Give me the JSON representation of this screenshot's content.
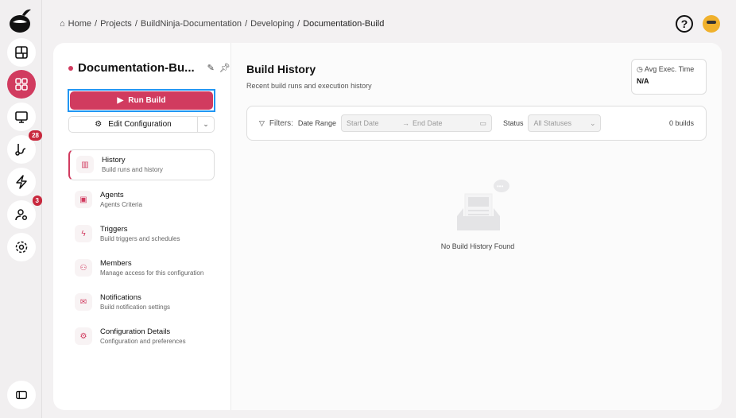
{
  "breadcrumb": {
    "items": [
      "Home",
      "Projects",
      "BuildNinja-Documentation",
      "Developing",
      "Documentation-Build"
    ],
    "separator": "/"
  },
  "rail": {
    "badges": {
      "vcs": "28",
      "users": "3"
    }
  },
  "config": {
    "title": "Documentation-Bu...",
    "run_label": "Run Build",
    "edit_label": "Edit Configuration"
  },
  "nav": [
    {
      "label": "History",
      "sub": "Build runs and history",
      "icon": "chart-icon"
    },
    {
      "label": "Agents",
      "sub": "Agents Criteria",
      "icon": "agent-icon"
    },
    {
      "label": "Triggers",
      "sub": "Build triggers and schedules",
      "icon": "lightning-icon"
    },
    {
      "label": "Members",
      "sub": "Manage access for this configuration",
      "icon": "members-icon"
    },
    {
      "label": "Notifications",
      "sub": "Build notification settings",
      "icon": "mail-icon"
    },
    {
      "label": "Configuration Details",
      "sub": "Configuration and preferences",
      "icon": "gear-icon"
    }
  ],
  "main": {
    "title": "Build History",
    "subtitle": "Recent build runs and execution history",
    "avg_label": "Avg Exec. Time",
    "avg_value": "N/A",
    "filters": {
      "label": "Filters:",
      "date_range": "Date Range",
      "start_placeholder": "Start Date",
      "end_placeholder": "End Date",
      "status": "Status",
      "status_value": "All Statuses",
      "count": "0 builds"
    },
    "empty": "No Build History Found"
  },
  "colors": {
    "accent": "#d13b5f",
    "focus": "#2196f3"
  }
}
